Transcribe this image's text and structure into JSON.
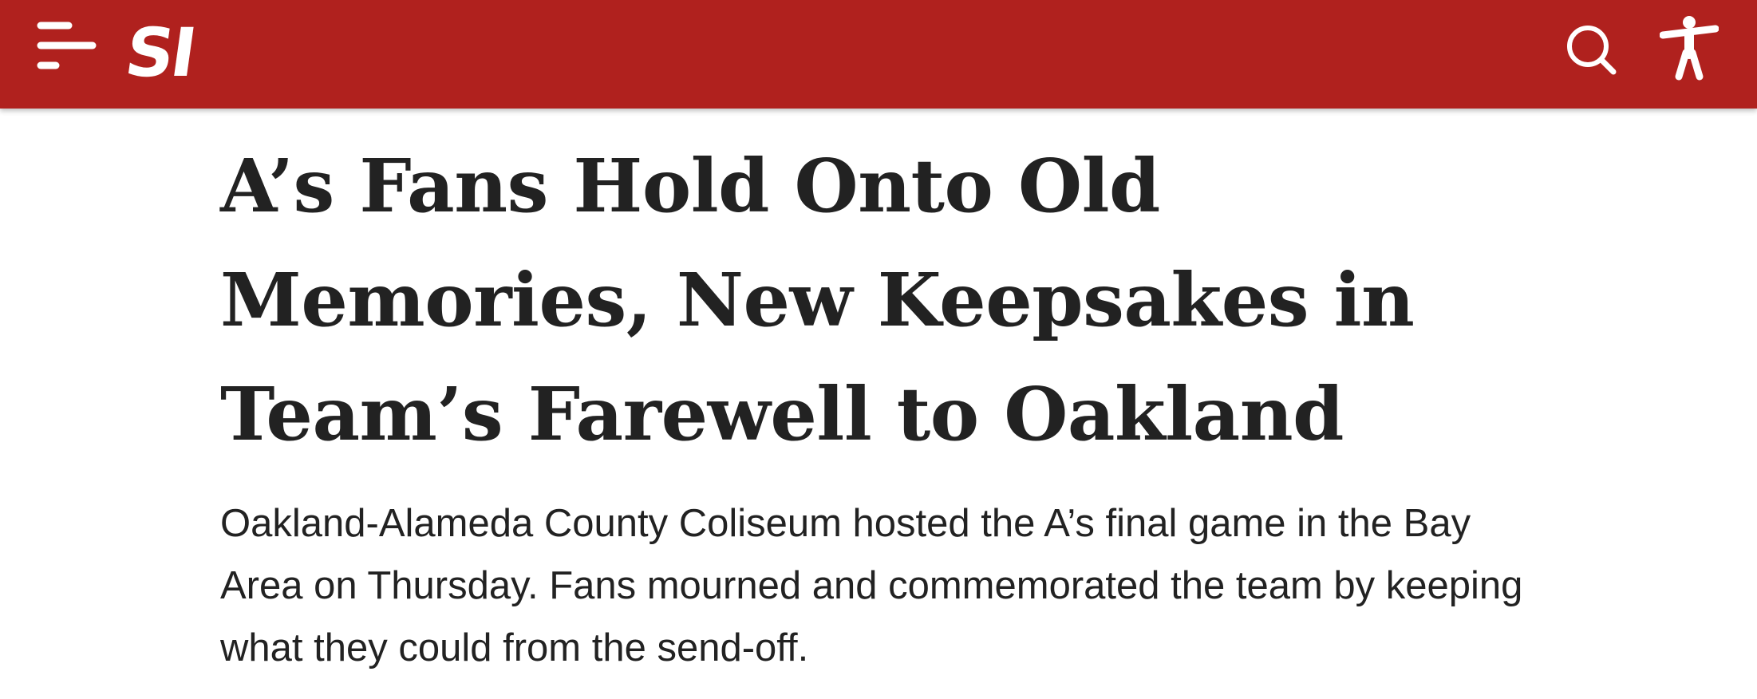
{
  "header": {
    "logo_text": "SI",
    "menu_icon": "hamburger-menu-icon",
    "search_icon": "search-icon",
    "accessibility_icon": "accessibility-icon",
    "brand_color": "#b0211e"
  },
  "article": {
    "headline": "A’s Fans Hold Onto Old Memories, New Keepsakes in Team’s Farewell to Oakland",
    "dek": "Oakland-Alameda County Coliseum hosted the A’s final game in the Bay Area on Thursday. Fans mourned and commemorated the team by keeping what they could from the send-off."
  }
}
